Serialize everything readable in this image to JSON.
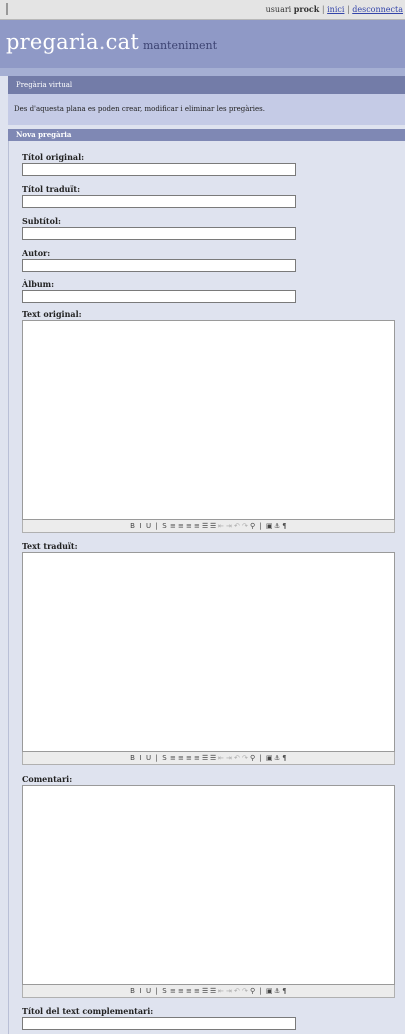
{
  "topbar": {
    "user_label": "usuari",
    "username": "prock",
    "link_home": "inici",
    "link_disconnect": "desconnecta",
    "separator": "|"
  },
  "header": {
    "site_name": "pregaria",
    "site_dot": ".",
    "site_tld": "cat",
    "site_sub": "manteniment"
  },
  "section": {
    "title": "Pregària virtual",
    "info": "Des d'aquesta plana es poden crear, modificar i eliminar les pregàries.",
    "form_title": "Nova pregària"
  },
  "form": {
    "fields": [
      {
        "label": "Títol original:",
        "value": ""
      },
      {
        "label": "Títol traduït:",
        "value": ""
      },
      {
        "label": "Subtítol:",
        "value": ""
      },
      {
        "label": "Autor:",
        "value": ""
      },
      {
        "label": "Àlbum:",
        "value": ""
      }
    ],
    "textareas": [
      {
        "label": "Text original:",
        "value": ""
      },
      {
        "label": "Text traduït:",
        "value": ""
      },
      {
        "label": "Comentari:",
        "value": ""
      }
    ],
    "last_field": {
      "label": "Títol del text complementari:",
      "value": ""
    }
  },
  "toolbar": {
    "buttons": [
      {
        "name": "bold-icon",
        "glyph": "B",
        "enabled": true
      },
      {
        "name": "italic-icon",
        "glyph": "I",
        "enabled": true
      },
      {
        "name": "underline-icon",
        "glyph": "U",
        "enabled": true
      },
      {
        "name": "separator-icon",
        "glyph": "|",
        "enabled": true
      },
      {
        "name": "strikethrough-icon",
        "glyph": "S",
        "enabled": true
      },
      {
        "name": "align-left-icon",
        "glyph": "≡",
        "enabled": true
      },
      {
        "name": "align-center-icon",
        "glyph": "≡",
        "enabled": true
      },
      {
        "name": "align-right-icon",
        "glyph": "≡",
        "enabled": true
      },
      {
        "name": "align-justify-icon",
        "glyph": "≡",
        "enabled": true
      },
      {
        "name": "bullet-list-icon",
        "glyph": "☰",
        "enabled": true
      },
      {
        "name": "numbered-list-icon",
        "glyph": "☰",
        "enabled": true
      },
      {
        "name": "outdent-icon",
        "glyph": "⇤",
        "enabled": false
      },
      {
        "name": "indent-icon",
        "glyph": "⇥",
        "enabled": false
      },
      {
        "name": "undo-icon",
        "glyph": "↶",
        "enabled": false
      },
      {
        "name": "redo-icon",
        "glyph": "↷",
        "enabled": false
      },
      {
        "name": "link-icon",
        "glyph": "⚲",
        "enabled": true
      },
      {
        "name": "separator-icon",
        "glyph": "|",
        "enabled": true
      },
      {
        "name": "image-icon",
        "glyph": "▣",
        "enabled": true
      },
      {
        "name": "anchor-icon",
        "glyph": "⚓",
        "enabled": true
      },
      {
        "name": "code-icon",
        "glyph": "¶",
        "enabled": true
      }
    ]
  }
}
